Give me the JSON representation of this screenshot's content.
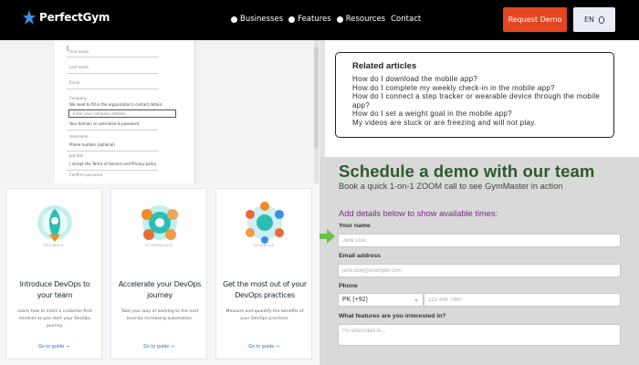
{
  "nav": {
    "brand": "PerfectGym",
    "links": [
      "Businesses",
      "Features",
      "Resources",
      "Contact"
    ],
    "request_demo": "Request Demo",
    "language": "EN"
  },
  "form_preview": {
    "rows": [
      "First name",
      "Last name",
      "Email",
      "Company",
      "We need to fill in the organization's contact details",
      "Enter your company address",
      "Your domain or username & password",
      "Username",
      "Phone number (optional)",
      "Job title",
      "I accept the Terms of Service and Privacy policy",
      "Confirm password"
    ]
  },
  "cards": [
    {
      "level": "BEGINNER",
      "title": "Introduce DevOps to your team",
      "desc": "Learn how to instill a customer-first mindset as you start your DevOps journey.",
      "link": "Go to guide →"
    },
    {
      "level": "INTERMEDIATE",
      "title": "Accelerate your DevOps journey",
      "desc": "Take your way of working to the next level by increasing automation.",
      "link": "Go to guide →"
    },
    {
      "level": "ADVANCED",
      "title": "Get the most out of your DevOps practices",
      "desc": "Measure and quantify the benefits of your DevOps practices.",
      "link": "Go to guide →"
    }
  ],
  "related": {
    "heading": "Related articles",
    "items": [
      "How do I download the mobile app?",
      "How do I complete my weekly check-in in the mobile app?",
      "How do I connect a step tracker or wearable device through the mobile app?",
      "How do I set a weight goal in the mobile app?",
      "My videos are stuck or are freezing and will not play."
    ]
  },
  "demo": {
    "title": "Schedule a demo with our team",
    "subtitle": "Book a quick 1-on-1 ZOOM call to see GymMaster in action",
    "hint": "Add details below to show available times:",
    "name_label": "Your name",
    "name_placeholder": "Jane Doe",
    "email_label": "Email address",
    "email_placeholder": "jane.doe@example.com",
    "phone_label": "Phone",
    "phone_country": "PK (+92)",
    "phone_placeholder": "123 456 7890",
    "features_label": "What features are you interested in?",
    "features_placeholder": "I'm interested in..."
  },
  "colors": {
    "nav_bg": "#000000",
    "accent": "#e3471f",
    "demo_title": "#2d5a2e",
    "hint": "#7a2a86",
    "arrow": "#6cc04a"
  }
}
